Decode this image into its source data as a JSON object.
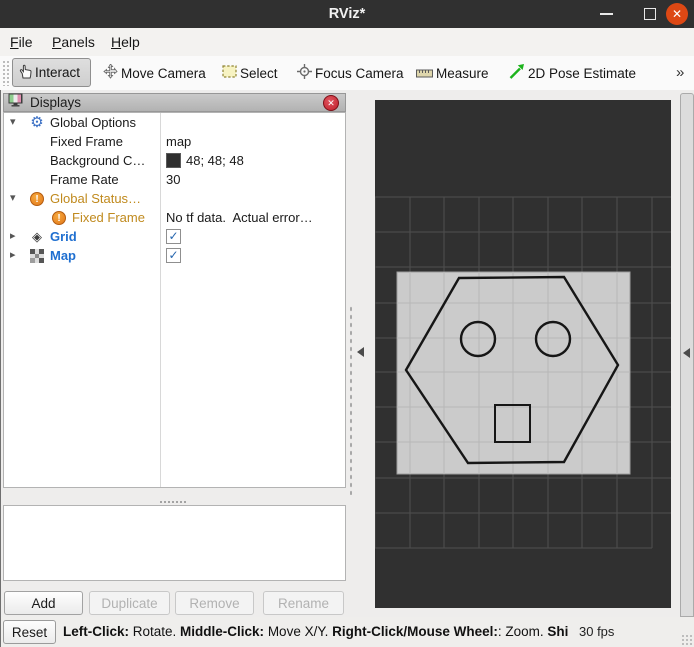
{
  "window": {
    "title": "RViz*"
  },
  "menubar": {
    "items": [
      {
        "label": "File"
      },
      {
        "label": "Panels"
      },
      {
        "label": "Help"
      }
    ]
  },
  "toolbar": {
    "tools": [
      {
        "label": "Interact",
        "active": true
      },
      {
        "label": "Move Camera",
        "active": false
      },
      {
        "label": "Select",
        "active": false
      },
      {
        "label": "Focus Camera",
        "active": false
      },
      {
        "label": "Measure",
        "active": false
      },
      {
        "label": "2D Pose Estimate",
        "active": false
      }
    ],
    "overflow": "»"
  },
  "displays": {
    "title": "Displays",
    "rows": [
      {
        "label": "Global Options",
        "value": ""
      },
      {
        "label": "Fixed Frame",
        "value": "map"
      },
      {
        "label": "Background C…",
        "value": "48; 48; 48",
        "swatch": "#2f2f2f"
      },
      {
        "label": "Frame Rate",
        "value": "30"
      },
      {
        "label": "Global Status…",
        "value": "",
        "status": "warning"
      },
      {
        "label": "Fixed Frame",
        "value": "No tf data.  Actual error…",
        "status": "warning"
      },
      {
        "label": "Grid",
        "checked": true
      },
      {
        "label": "Map",
        "checked": true
      }
    ],
    "buttons": [
      {
        "label": "Add",
        "enabled": true
      },
      {
        "label": "Duplicate",
        "enabled": false
      },
      {
        "label": "Remove",
        "enabled": false
      },
      {
        "label": "Rename",
        "enabled": false
      }
    ]
  },
  "statusbar": {
    "reset_label": "Reset",
    "help_segments": [
      {
        "text": "Left-Click:",
        "bold": true
      },
      {
        "text": " Rotate. ",
        "bold": false
      },
      {
        "text": "Middle-Click:",
        "bold": true
      },
      {
        "text": " Move X/Y. ",
        "bold": false
      },
      {
        "text": "Right-Click/Mouse Wheel:",
        "bold": true
      },
      {
        "text": ": Zoom. ",
        "bold": false
      },
      {
        "text": "Shi",
        "bold": true
      }
    ],
    "fps": "30 fps"
  },
  "viewport": {
    "background": "#303030",
    "map_fill": "#cbcbcb",
    "grid_dark_line": "#4f4f4f",
    "grid_light_line": "#b7b7b7",
    "map_outline": "#161616"
  },
  "colors": {
    "display_name_blue": "#1f6fd0",
    "warning_text": "#c08a1e",
    "window_close": "#DD4814",
    "panel_close": "#bf1f2a"
  }
}
